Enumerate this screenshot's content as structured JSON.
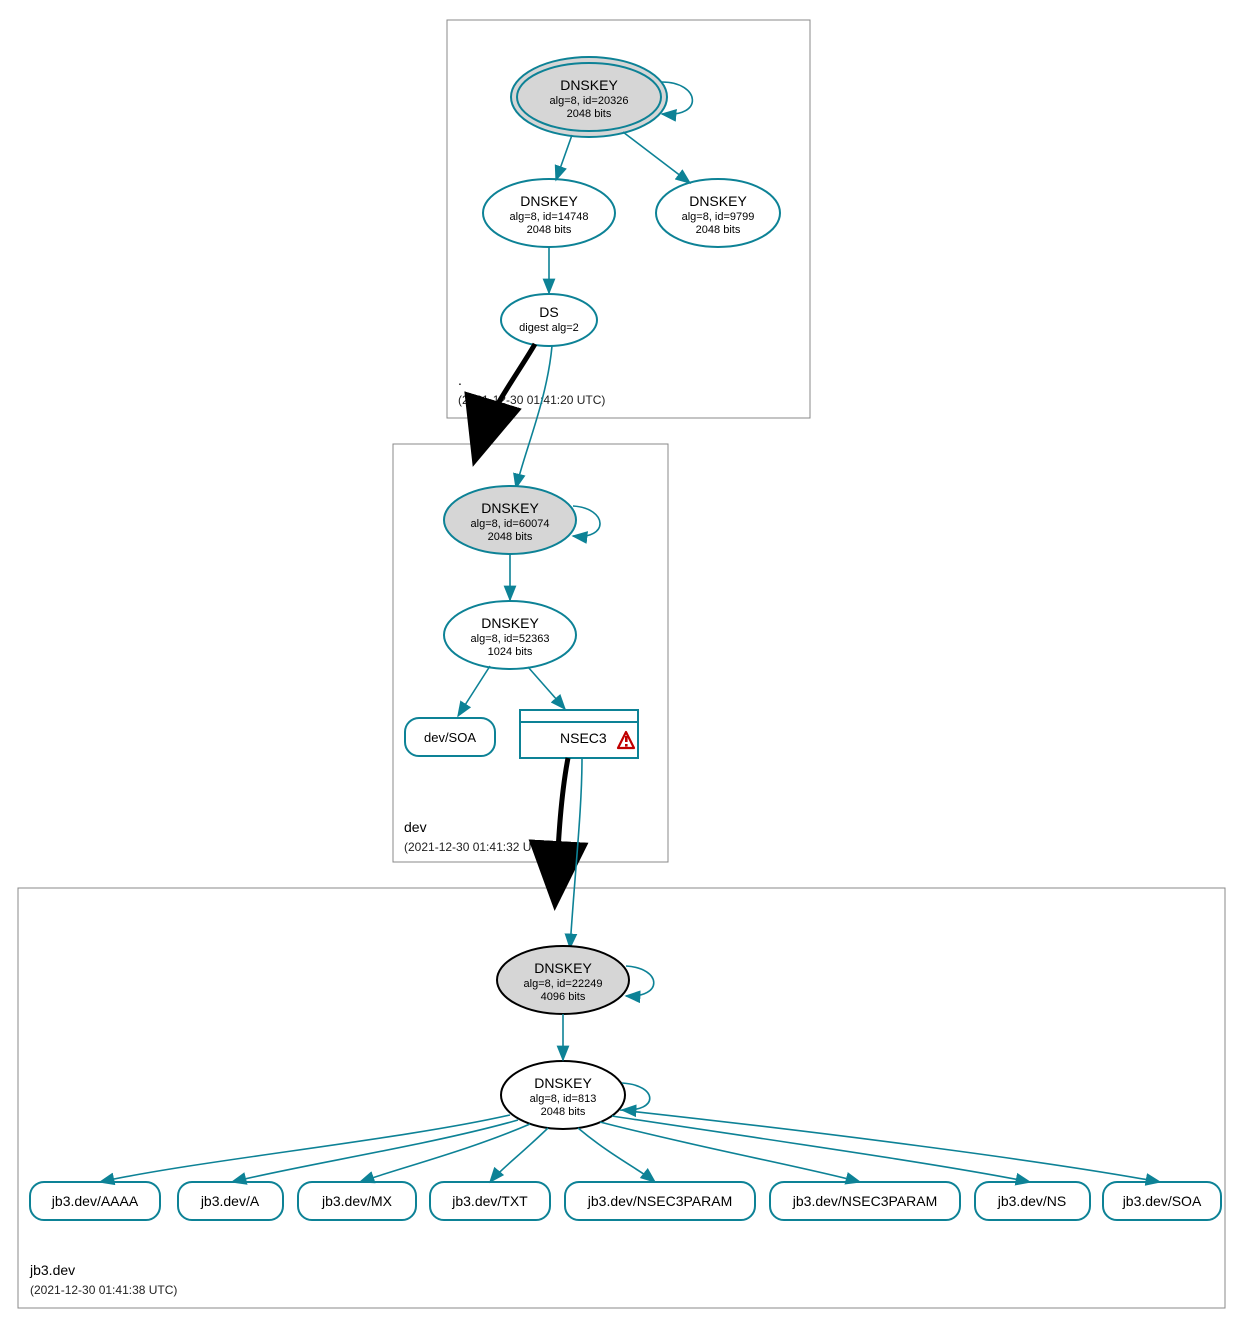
{
  "zones": {
    "root": {
      "label": ".",
      "timestamp": "(2021-12-30 01:41:20 UTC)"
    },
    "dev": {
      "label": "dev",
      "timestamp": "(2021-12-30 01:41:32 UTC)"
    },
    "jb3": {
      "label": "jb3.dev",
      "timestamp": "(2021-12-30 01:41:38 UTC)"
    }
  },
  "nodes": {
    "root_ksk": {
      "title": "DNSKEY",
      "alg": "alg=8, id=20326",
      "bits": "2048 bits"
    },
    "root_zsk1": {
      "title": "DNSKEY",
      "alg": "alg=8, id=14748",
      "bits": "2048 bits"
    },
    "root_zsk2": {
      "title": "DNSKEY",
      "alg": "alg=8, id=9799",
      "bits": "2048 bits"
    },
    "root_ds": {
      "title": "DS",
      "alg": "digest alg=2"
    },
    "dev_ksk": {
      "title": "DNSKEY",
      "alg": "alg=8, id=60074",
      "bits": "2048 bits"
    },
    "dev_zsk": {
      "title": "DNSKEY",
      "alg": "alg=8, id=52363",
      "bits": "1024 bits"
    },
    "dev_soa": {
      "label": "dev/SOA"
    },
    "dev_nsec3": {
      "label": "NSEC3"
    },
    "jb3_ksk": {
      "title": "DNSKEY",
      "alg": "alg=8, id=22249",
      "bits": "4096 bits"
    },
    "jb3_zsk": {
      "title": "DNSKEY",
      "alg": "alg=8, id=813",
      "bits": "2048 bits"
    },
    "leaves": [
      "jb3.dev/AAAA",
      "jb3.dev/A",
      "jb3.dev/MX",
      "jb3.dev/TXT",
      "jb3.dev/NSEC3PARAM",
      "jb3.dev/NSEC3PARAM",
      "jb3.dev/NS",
      "jb3.dev/SOA"
    ]
  },
  "colors": {
    "teal": "#0d8296",
    "warn": "#c00000",
    "grey_fill": "#d6d6d6"
  }
}
